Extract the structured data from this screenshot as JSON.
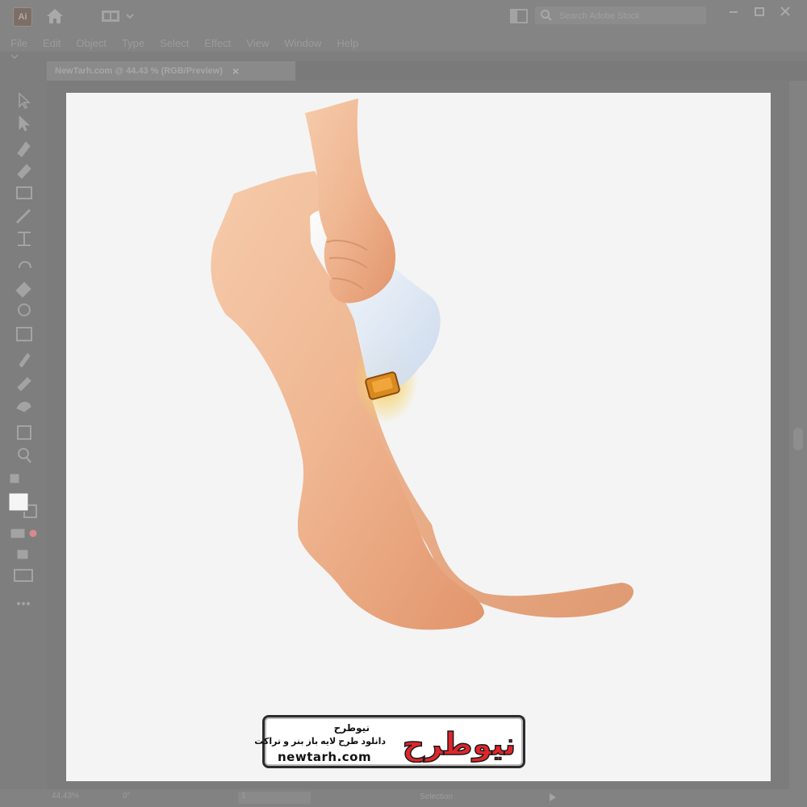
{
  "app": {
    "logo_text": "Ai"
  },
  "search": {
    "placeholder": "Search Adobe Stock"
  },
  "menu": {
    "items": [
      "File",
      "Edit",
      "Object",
      "Type",
      "Select",
      "Effect",
      "View",
      "Window",
      "Help"
    ]
  },
  "document_tab": {
    "label": "NewTarh.com @ 44.43 % (RGB/Preview)",
    "close": "×"
  },
  "status": {
    "zoom": "44.43%",
    "rotation": "0°",
    "artboard": "1",
    "tool": "Selection"
  },
  "watermark": {
    "title": "نیوطرح",
    "subtitle": "دانلود طرح لایه باز بنر و تراکت",
    "url": "newtarh.com",
    "logo_text": "نیوطرح",
    "accent": "#e0262b"
  },
  "colors": {
    "chrome": "#848484",
    "artboard": "#f4f4f4",
    "skin": "#efb691",
    "device": "#dfe8f3",
    "device_window": "#d98a1e"
  }
}
